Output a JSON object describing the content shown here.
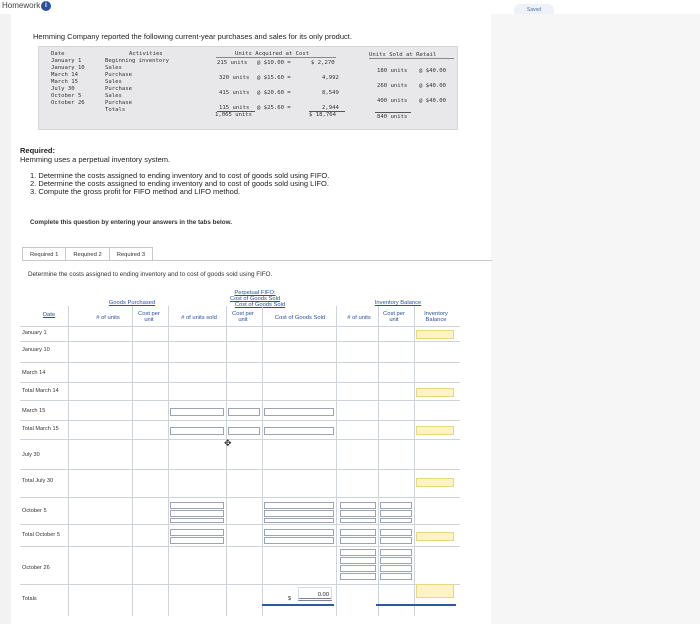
{
  "top": {
    "breadcrumb": "Homework",
    "info_icon": "i",
    "saved": "Saved"
  },
  "intro": "Hemming Company reported the following current-year purchases and sales for its only product.",
  "table": {
    "dates_header": "Date",
    "activities_header": "Activities",
    "units_header": "Units Acquired at Cost",
    "retail_header": "Units Sold at Retail",
    "rows": [
      {
        "date": "January 1",
        "activity": "Beginning inventory",
        "units": "215 units",
        "cost": "@ $10.00 =",
        "total": "$ 2,270"
      },
      {
        "date": "January 10",
        "activity": "Sales",
        "sold": "180 units",
        "retail": "@ $40.00"
      },
      {
        "date": "March 14",
        "activity": "Purchase",
        "units": "320 units",
        "cost": "@ $15.60 =",
        "total": "4,992"
      },
      {
        "date": "March 15",
        "activity": "Sales",
        "sold": "260 units",
        "retail": "@ $40.00"
      },
      {
        "date": "July 30",
        "activity": "Purchase",
        "units": "415 units",
        "cost": "@ $20.60 =",
        "total": "8,549"
      },
      {
        "date": "October 5",
        "activity": "Sales",
        "sold": "400 units",
        "retail": "@ $40.00"
      },
      {
        "date": "October 26",
        "activity": "Purchase",
        "units": "115 units",
        "cost": "@ $25.60 =",
        "total": "2,944"
      }
    ],
    "totals_label": "Totals",
    "totals_units": "1,065 units",
    "totals_cost": "$ 18,764",
    "totals_sold": "840 units"
  },
  "required": {
    "title": "Required:",
    "text": "Hemming uses a perpetual inventory system.",
    "tasks": [
      "1. Determine the costs assigned to ending inventory and to cost of goods sold using FIFO.",
      "2. Determine the costs assigned to ending inventory and to cost of goods sold using LIFO.",
      "3. Compute the gross profit for FIFO method and LIFO method."
    ]
  },
  "complete_note": "Complete this question by entering your answers in the tabs below.",
  "tabs": [
    "Required 1",
    "Required 2",
    "Required 3"
  ],
  "determine": "Determine the costs assigned to ending inventory and to cost of goods sold using FIFO.",
  "worksheet": {
    "perpetual": "Perpetual FIFO:",
    "cogs_header": "Cost of Goods Sold",
    "goods_purchased": "Goods Purchased",
    "cogs_sub": "Cost of Goods Sold",
    "inventory_balance": "Inventory Balance",
    "date": "Date",
    "units": "# of units",
    "cost_per_unit": "Cost per unit",
    "units_sold": "# of units sold",
    "cost_of_goods_sold": "Cost of Goods Sold",
    "inventory_bal_col": "Inventory Balance",
    "row_labels": [
      "January 1",
      "January 10",
      "March 14",
      "Total March 14",
      "March 15",
      "Total March 15",
      "July 30",
      "Total July 30",
      "October 5",
      "Total October 5",
      "October 26",
      "Totals"
    ],
    "total_dollar": "$",
    "total_value": "0.00"
  }
}
